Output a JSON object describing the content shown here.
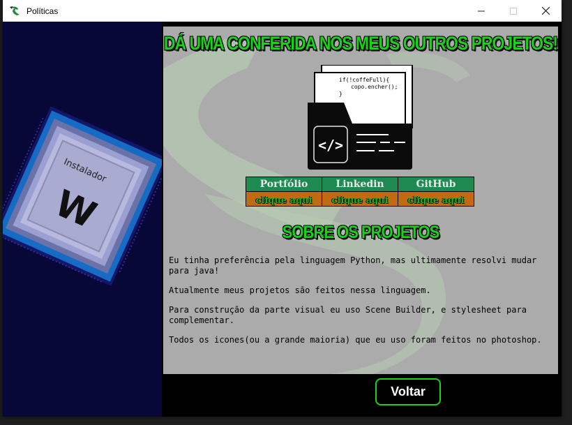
{
  "window": {
    "title": "Políticas",
    "controls": {
      "minimize": "—",
      "maximize": "☐",
      "close": "✕"
    }
  },
  "left_panel": {
    "chip_label": "Instalador",
    "chip_letter": "W"
  },
  "main": {
    "heading": "DÁ UMA CONFERIDA NOS MEUS OUTROS PROJETOS!",
    "code_illustration": {
      "line1": "if(!coffeFull){",
      "line2": "copo.encher();",
      "line3": "}",
      "tag_symbol": "</>"
    },
    "links": {
      "headers": [
        "Portfólio",
        "Linkedin",
        "GitHub"
      ],
      "cells": [
        "clique aqui",
        "clique aqui",
        "clique aqui"
      ]
    },
    "about_heading": "SOBRE OS PROJETOS",
    "about_paragraphs": [
      "Eu tinha preferência pela linguagem Python, mas ultimamente resolvi mudar para java!",
      "Atualmente meus projetos são feitos nessa linguagem.",
      "Para construção da parte visual eu uso Scene Builder, e stylesheet para complementar.",
      "Todos os icones(ou a grande maioria) que eu uso foram feitos no photoshop."
    ]
  },
  "footer": {
    "back_label": "Voltar"
  },
  "colors": {
    "accent_green": "#19d219",
    "header_green": "#1e8a52",
    "link_orange": "#c16a12",
    "panel_gray": "#ababab",
    "left_navy": "#070738"
  }
}
